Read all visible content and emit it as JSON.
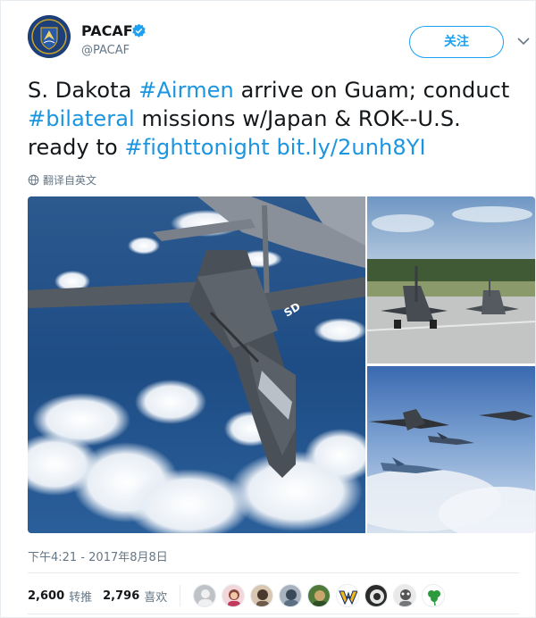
{
  "user": {
    "display_name": "PACAF",
    "handle": "@PACAF",
    "verified": true,
    "avatar_icon": "pacaf-emblem",
    "follow_label": "关注"
  },
  "tweet": {
    "text_parts": [
      {
        "text": "S. Dakota ",
        "link": false
      },
      {
        "text": "#Airmen",
        "link": true
      },
      {
        "text": " arrive on Guam; conduct ",
        "link": false
      },
      {
        "text": "#bilateral",
        "link": true
      },
      {
        "text": " missions w/Japan & ROK--U.S. ready to ",
        "link": false
      },
      {
        "text": "#fighttonight",
        "link": true
      },
      {
        "text": " ",
        "link": false
      },
      {
        "text": "bit.ly/2unh8YI",
        "link": true
      }
    ],
    "translate_label": "翻译自英文",
    "timestamp": "下午4:21 - 2017年8月8日"
  },
  "stats": {
    "retweets": "2,600",
    "retweets_label": "转推",
    "likes": "2,796",
    "likes_label": "喜欢"
  },
  "likers_count": 9,
  "colors": {
    "link": "#1b95e0",
    "accent": "#1da1f2",
    "secondary_text": "#657786",
    "border": "#e6ecf0"
  }
}
